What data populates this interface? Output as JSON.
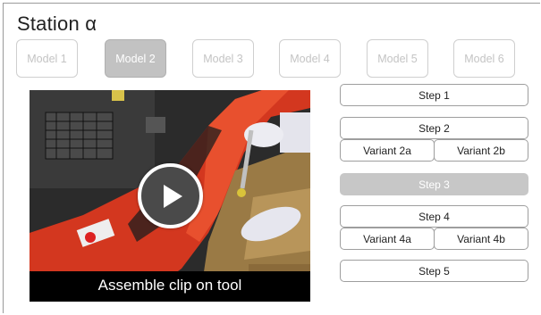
{
  "station": {
    "title": "Station α"
  },
  "models": [
    {
      "label": "Model 1",
      "active": false
    },
    {
      "label": "Model 2",
      "active": true
    },
    {
      "label": "Model 3",
      "active": false
    },
    {
      "label": "Model 4",
      "active": false
    },
    {
      "label": "Model 5",
      "active": false
    },
    {
      "label": "Model 6",
      "active": false
    }
  ],
  "video": {
    "caption": "Assemble clip on tool",
    "play_icon": "play-icon"
  },
  "steps": [
    {
      "label": "Step 1"
    },
    {
      "label": "Step 2",
      "variants": [
        "Variant 2a",
        "Variant 2b"
      ]
    },
    {
      "label": "Step 3",
      "active": true
    },
    {
      "label": "Step 4",
      "variants": [
        "Variant 4a",
        "Variant 4b"
      ]
    },
    {
      "label": "Step 5"
    }
  ],
  "colors": {
    "active_model": "#c2c2c2",
    "active_step": "#c7c7c7",
    "inactive_text": "#c4c4c4"
  }
}
